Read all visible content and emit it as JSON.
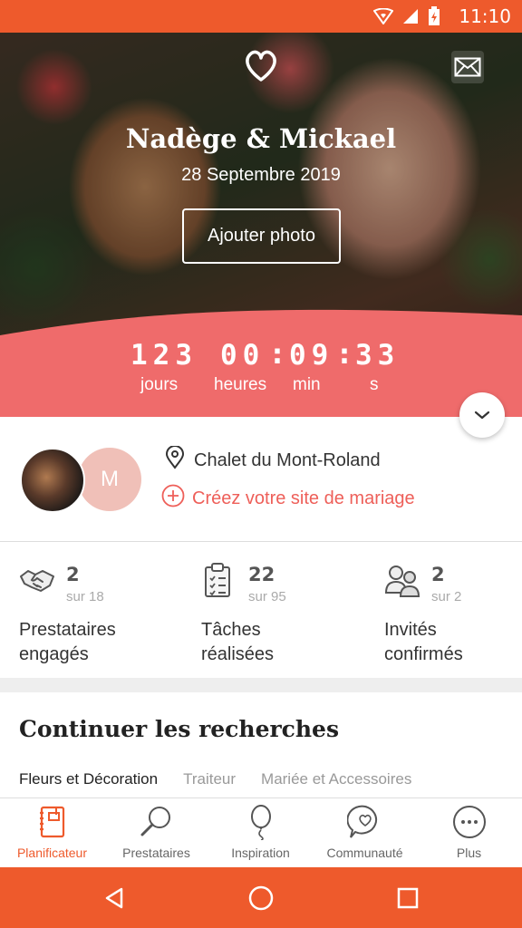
{
  "status_bar": {
    "time": "11:10"
  },
  "hero": {
    "couple_names": "Nadège & Mickael",
    "date": "28 Septembre 2019",
    "add_photo_label": "Ajouter photo"
  },
  "countdown": {
    "days": "123",
    "hours": "00",
    "minutes": "09",
    "seconds": "33",
    "days_label": "jours",
    "hours_label": "heures",
    "minutes_label": "min",
    "seconds_label": "s"
  },
  "info": {
    "avatar_initial": "M",
    "venue": "Chalet du Mont-Roland",
    "create_site_label": "Créez votre site de mariage"
  },
  "stats": [
    {
      "value": "2",
      "of": "sur 18",
      "label_line1": "Prestataires",
      "label_line2": "engagés",
      "icon": "handshake-icon"
    },
    {
      "value": "22",
      "of": "sur 95",
      "label_line1": "Tâches",
      "label_line2": "réalisées",
      "icon": "clipboard-icon"
    },
    {
      "value": "2",
      "of": "sur 2",
      "label_line1": "Invités",
      "label_line2": "confirmés",
      "icon": "guests-icon"
    }
  ],
  "continue": {
    "title": "Continuer les recherches",
    "tabs": [
      "Fleurs et Décoration",
      "Traiteur",
      "Mariée et Accessoires"
    ]
  },
  "bottom_nav": [
    {
      "label": "Planificateur",
      "icon": "planner-icon",
      "active": true
    },
    {
      "label": "Prestataires",
      "icon": "search-icon"
    },
    {
      "label": "Inspiration",
      "icon": "balloon-icon"
    },
    {
      "label": "Communauté",
      "icon": "chat-heart-icon"
    },
    {
      "label": "Plus",
      "icon": "more-icon"
    }
  ],
  "colors": {
    "accent": "#ee5a2c",
    "coral": "#ef6b6b"
  }
}
